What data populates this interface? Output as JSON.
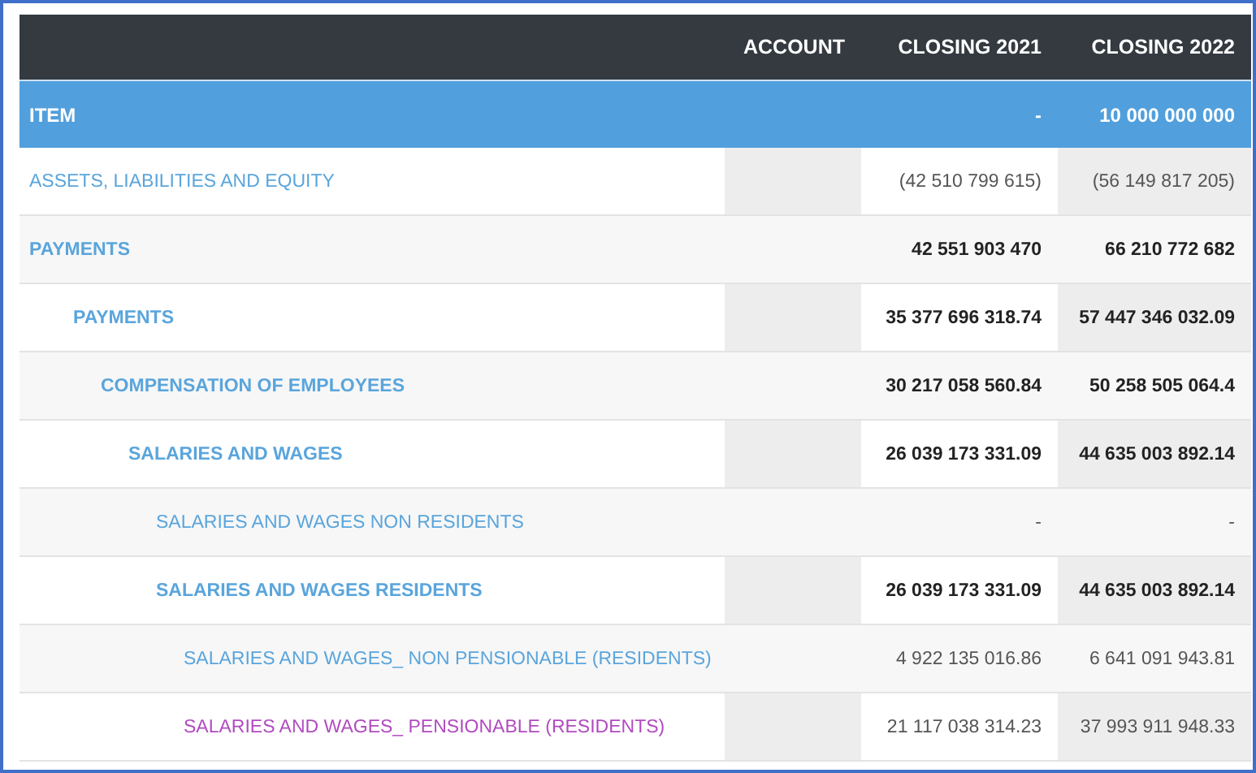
{
  "table": {
    "columns": [
      "",
      "ACCOUNT",
      "CLOSING 2021",
      "CLOSING 2022"
    ],
    "total_row": {
      "label": "ITEM",
      "closing_2021": "-",
      "closing_2022": "10 000 000 000"
    },
    "rows": [
      {
        "label": "ASSETS, LIABILITIES AND EQUITY",
        "bold": false,
        "color": "#5aa5dc",
        "closing_2021": "(42 510 799 615)",
        "closing_2022": "(56 149 817 205)"
      },
      {
        "label": "PAYMENTS",
        "bold": true,
        "color": "#5aa5dc",
        "closing_2021": "42 551 903 470",
        "closing_2022": "66 210 772 682",
        "children": [
          {
            "label": "PAYMENTS",
            "bold": true,
            "color": "#5aa5dc",
            "closing_2021": "35 377 696 318.74",
            "closing_2022": "57 447 346 032.09",
            "children": [
              {
                "label": "COMPENSATION OF EMPLOYEES",
                "bold": true,
                "color": "#5aa5dc",
                "closing_2021": "30 217 058 560.84",
                "closing_2022": "50 258 505 064.4",
                "children": [
                  {
                    "label": "SALARIES AND WAGES",
                    "bold": true,
                    "color": "#5aa5dc",
                    "closing_2021": "26 039 173 331.09",
                    "closing_2022": "44 635 003 892.14",
                    "children": [
                      {
                        "label": "SALARIES AND WAGES NON RESIDENTS",
                        "bold": false,
                        "color": "#5aa5dc",
                        "closing_2021": "-",
                        "closing_2022": "-"
                      },
                      {
                        "label": "SALARIES AND WAGES RESIDENTS",
                        "bold": true,
                        "color": "#5aa5dc",
                        "closing_2021": "26 039 173 331.09",
                        "closing_2022": "44 635 003 892.14",
                        "children": [
                          {
                            "label": "SALARIES AND WAGES_ NON PENSIONABLE (RESIDENTS)",
                            "bold": false,
                            "color": "#5aa5dc",
                            "closing_2021": "4 922 135 016.86",
                            "closing_2022": "6 641 091 943.81"
                          },
                          {
                            "label": "SALARIES AND WAGES_ PENSIONABLE (RESIDENTS)",
                            "bold": false,
                            "color": "#b04cbf",
                            "closing_2021": "21 117 038 314.23",
                            "closing_2022": "37 993 911 948.33"
                          }
                        ]
                      }
                    ]
                  }
                ]
              }
            ]
          }
        ]
      }
    ]
  }
}
